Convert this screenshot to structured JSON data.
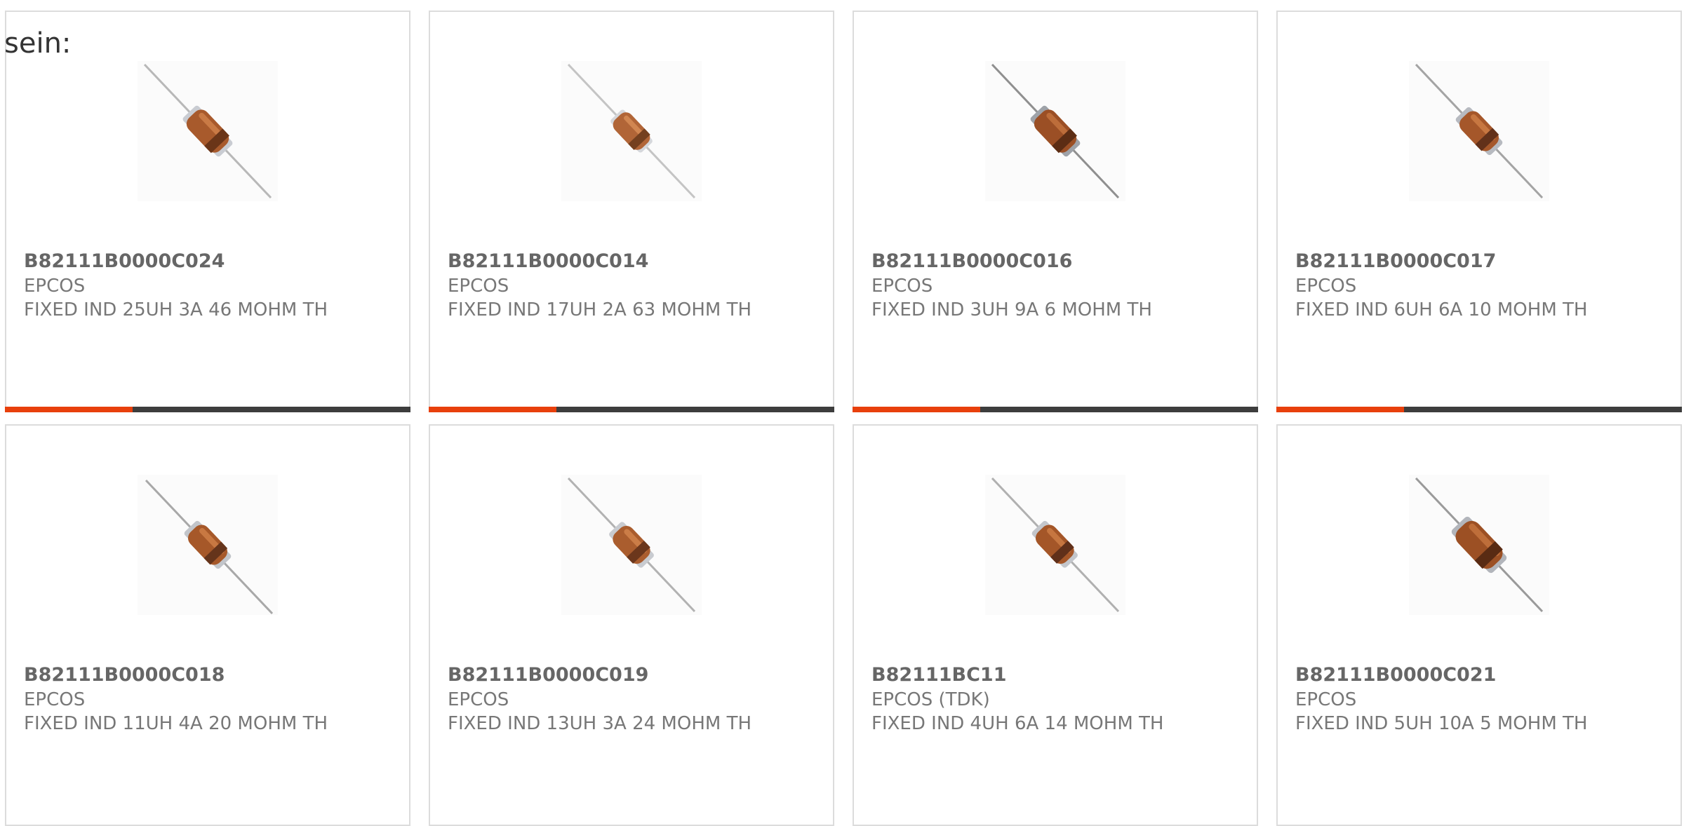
{
  "heading": "sein:",
  "colors": {
    "accent": "#e8400c",
    "bar_track": "#3d3d3d",
    "card_border": "#dcdcdc"
  },
  "products": [
    {
      "part_number": "B82111B0000C024",
      "manufacturer": "EPCOS",
      "description": "FIXED IND 25UH 3A 46 MOHM TH",
      "image_icon": "axial-inductor-icon"
    },
    {
      "part_number": "B82111B0000C014",
      "manufacturer": "EPCOS",
      "description": "FIXED IND 17UH 2A 63 MOHM TH",
      "image_icon": "axial-inductor-icon"
    },
    {
      "part_number": "B82111B0000C016",
      "manufacturer": "EPCOS",
      "description": "FIXED IND 3UH 9A 6 MOHM TH",
      "image_icon": "axial-inductor-icon"
    },
    {
      "part_number": "B82111B0000C017",
      "manufacturer": "EPCOS",
      "description": "FIXED IND 6UH 6A 10 MOHM TH",
      "image_icon": "axial-inductor-icon"
    },
    {
      "part_number": "B82111B0000C018",
      "manufacturer": "EPCOS",
      "description": "FIXED IND 11UH 4A 20 MOHM TH",
      "image_icon": "axial-inductor-icon"
    },
    {
      "part_number": "B82111B0000C019",
      "manufacturer": "EPCOS",
      "description": "FIXED IND 13UH 3A 24 MOHM TH",
      "image_icon": "axial-inductor-icon"
    },
    {
      "part_number": "B82111BC11",
      "manufacturer": "EPCOS (TDK)",
      "description": "FIXED IND 4UH 6A 14 MOHM TH",
      "image_icon": "axial-inductor-icon"
    },
    {
      "part_number": "B82111B0000C021",
      "manufacturer": "EPCOS",
      "description": "FIXED IND 5UH 10A 5 MOHM TH",
      "image_icon": "axial-inductor-icon"
    }
  ]
}
